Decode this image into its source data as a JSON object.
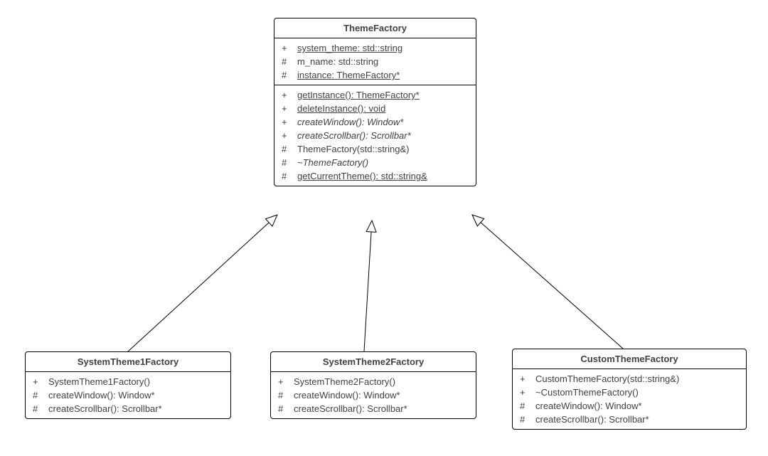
{
  "diagram_type": "uml_class_diagram",
  "relationships": [
    {
      "from": "SystemTheme1Factory",
      "to": "ThemeFactory",
      "kind": "generalization"
    },
    {
      "from": "SystemTheme2Factory",
      "to": "ThemeFactory",
      "kind": "generalization"
    },
    {
      "from": "CustomThemeFactory",
      "to": "ThemeFactory",
      "kind": "generalization"
    }
  ],
  "classes": {
    "theme_factory": {
      "name": "ThemeFactory",
      "attributes": [
        {
          "vis": "+",
          "text": "system_theme: std::string",
          "static": true
        },
        {
          "vis": "#",
          "text": "m_name: std::string"
        },
        {
          "vis": "#",
          "text": "instance: ThemeFactory*",
          "static": true
        }
      ],
      "operations": [
        {
          "vis": "+",
          "text": "getInstance(): ThemeFactory*",
          "static": true
        },
        {
          "vis": "+",
          "text": "deleteInstance(): void",
          "static": true
        },
        {
          "vis": "+",
          "text": "createWindow(): Window*",
          "abstract": true
        },
        {
          "vis": "+",
          "text": "createScrollbar(): Scrollbar*",
          "abstract": true
        },
        {
          "vis": "#",
          "text": "ThemeFactory(std::string&)"
        },
        {
          "vis": "#",
          "text": "~ThemeFactory()",
          "abstract": true
        },
        {
          "vis": "#",
          "text": "getCurrentTheme(): std::string&",
          "static": true
        }
      ]
    },
    "system_theme1": {
      "name": "SystemTheme1Factory",
      "operations": [
        {
          "vis": "+",
          "text": "SystemTheme1Factory()"
        },
        {
          "vis": "#",
          "text": "createWindow(): Window*"
        },
        {
          "vis": "#",
          "text": "createScrollbar(): Scrollbar*"
        }
      ]
    },
    "system_theme2": {
      "name": "SystemTheme2Factory",
      "operations": [
        {
          "vis": "+",
          "text": "SystemTheme2Factory()"
        },
        {
          "vis": "#",
          "text": "createWindow(): Window*"
        },
        {
          "vis": "#",
          "text": "createScrollbar(): Scrollbar*"
        }
      ]
    },
    "custom_theme": {
      "name": "CustomThemeFactory",
      "operations": [
        {
          "vis": "+",
          "text": "CustomThemeFactory(std::string&)"
        },
        {
          "vis": "+",
          "text": "~CustomThemeFactory()"
        },
        {
          "vis": "#",
          "text": "createWindow(): Window*"
        },
        {
          "vis": "#",
          "text": "createScrollbar(): Scrollbar*"
        }
      ]
    }
  }
}
